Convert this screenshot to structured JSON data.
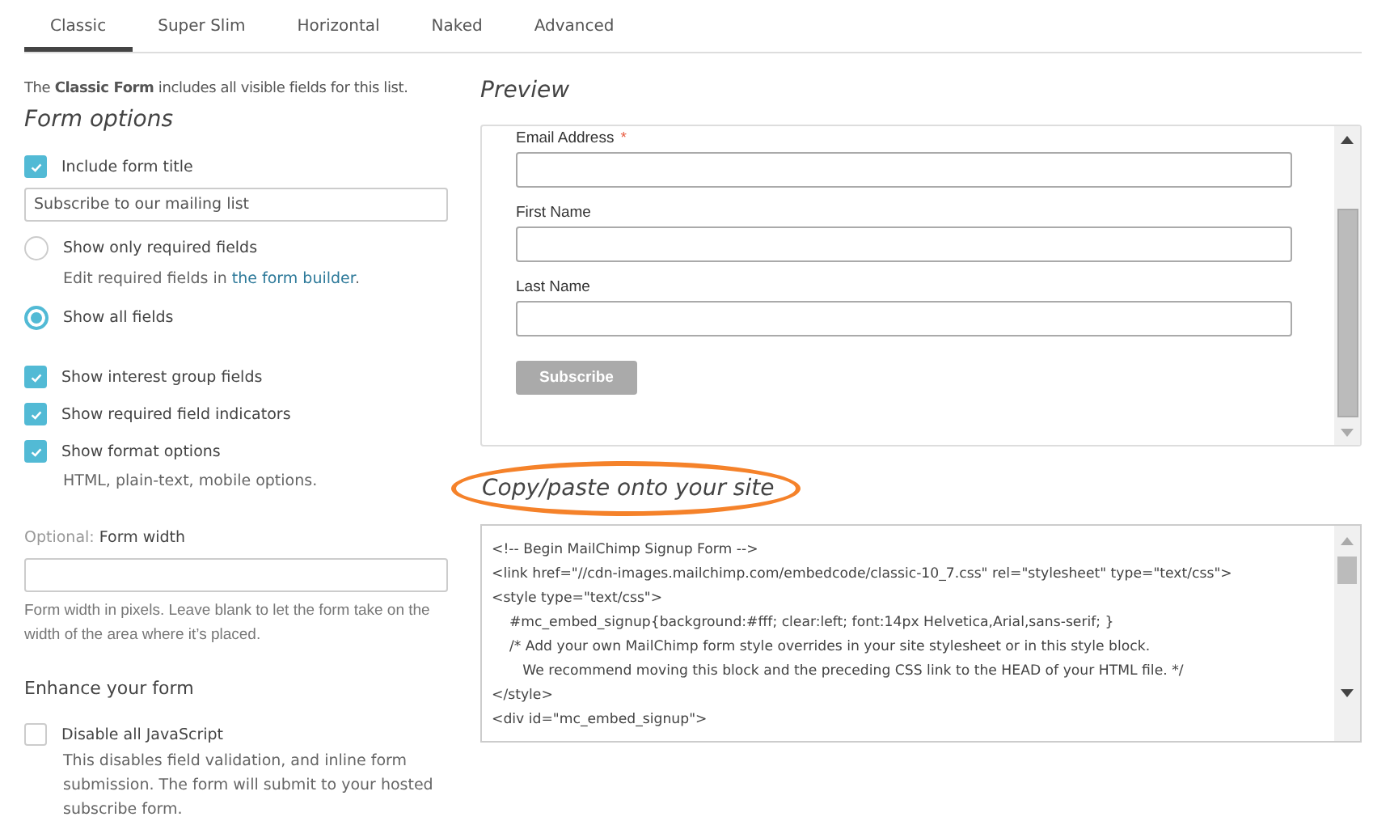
{
  "tabs": [
    {
      "label": "Classic",
      "selected": true
    },
    {
      "label": "Super Slim",
      "selected": false
    },
    {
      "label": "Horizontal",
      "selected": false
    },
    {
      "label": "Naked",
      "selected": false
    },
    {
      "label": "Advanced",
      "selected": false
    }
  ],
  "intro": "The **Classic Form** includes all visible fields for this list.",
  "form_options": {
    "title": "Form options",
    "options": [
      {
        "kind": "checkbox",
        "label": "Include form title",
        "checked": true,
        "value": "Subscribe to our mailing list"
      },
      {
        "kind": "radio",
        "label": "Show only required fields",
        "selected": false,
        "note": "Edit required fields in",
        "note_link": "the form builder",
        "note_end": "."
      },
      {
        "kind": "radio",
        "label": "Show all fields",
        "selected": true
      },
      {
        "kind": "checkbox",
        "label": "Show interest group fields",
        "checked": true
      },
      {
        "kind": "checkbox",
        "label": "Show required field indicators",
        "checked": true
      },
      {
        "kind": "checkbox",
        "label": "Show format options",
        "checked": true,
        "note": "HTML, plain-text, mobile options."
      }
    ]
  },
  "form_width": {
    "prefix": "Optional:",
    "label": "Form width",
    "hint": "Form width in pixels. Leave blank to let the form take on the width of the area where it’s placed."
  },
  "enhance": {
    "title": "Enhance your form",
    "options": [
      {
        "kind": "checkbox",
        "label": "Disable all JavaScript",
        "checked": false,
        "note": "This disables field validation, and inline form submission. The form will submit to your hosted subscribe form."
      }
    ]
  },
  "preview": {
    "title": "Preview",
    "fields": [
      {
        "label": "Email Address",
        "marker": "*"
      },
      {
        "label": "First Name"
      },
      {
        "label": "Last Name"
      }
    ],
    "button": "Subscribe"
  },
  "copy": {
    "title": "Copy/paste onto your site",
    "highlighted": true,
    "code_lines": [
      "<!-- Begin MailChimp Signup Form -->",
      "<link href=\"//cdn-images.mailchimp.com/embedcode/classic-10_7.css\" rel=\"stylesheet\" type=\"text/css\">",
      "<style type=\"text/css\">",
      "\t#mc_embed_signup{background:#fff; clear:left; font:14px Helvetica,Arial,sans-serif; }",
      "\t/* Add your own MailChimp form style overrides in your site stylesheet or in this style block.",
      "\t   We recommend moving this block and the preceding CSS link to the HEAD of your HTML file. */",
      "</style>",
      "<div id=\"mc_embed_signup\">"
    ]
  }
}
